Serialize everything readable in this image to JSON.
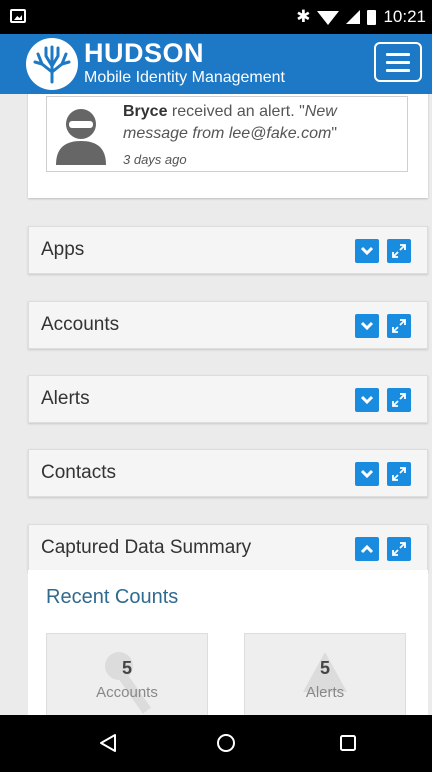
{
  "status_bar": {
    "time": "10:21",
    "bluetooth_icon": "bluetooth-icon",
    "wifi_icon": "wifi-icon",
    "signal_icon": "signal-icon",
    "battery_icon": "battery-icon"
  },
  "header": {
    "title": "HUDSON",
    "subtitle": "Mobile Identity Management",
    "logo_icon": "tree-logo-icon",
    "menu_icon": "hamburger-menu-icon",
    "color": "#1d78c5"
  },
  "alert": {
    "user": "Bryce",
    "action": " received an alert. \"",
    "message": "New message from lee@fake.com",
    "close_quote": "\"",
    "time": "3 days ago"
  },
  "panels": [
    {
      "title": "Apps",
      "state": "collapsed"
    },
    {
      "title": "Accounts",
      "state": "collapsed"
    },
    {
      "title": "Alerts",
      "state": "collapsed"
    },
    {
      "title": "Contacts",
      "state": "collapsed"
    },
    {
      "title": "Captured Data Summary",
      "state": "expanded"
    }
  ],
  "summary": {
    "heading": "Recent Counts",
    "tiles": [
      {
        "value": "5",
        "label": "Accounts",
        "icon": "key-icon"
      },
      {
        "value": "5",
        "label": "Alerts",
        "icon": "warning-icon"
      }
    ]
  },
  "nav_bar": {
    "back_icon": "back-icon",
    "home_icon": "home-icon",
    "recents_icon": "recents-icon"
  },
  "accent_color": "#1a8ce0"
}
